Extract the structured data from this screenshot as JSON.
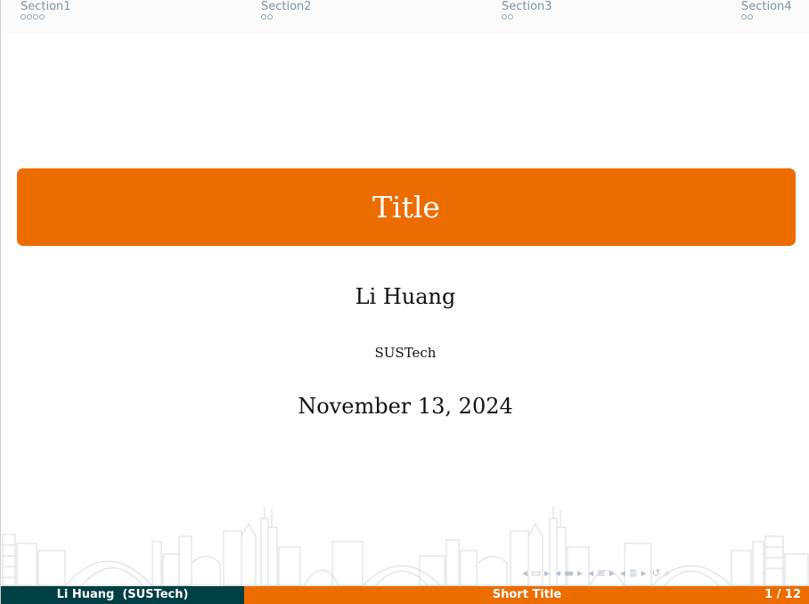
{
  "navbar": {
    "sections": [
      {
        "label": "Section1",
        "dots": 4
      },
      {
        "label": "Section2",
        "dots": 2
      },
      {
        "label": "Section3",
        "dots": 2
      },
      {
        "label": "Section4",
        "dots": 2
      }
    ]
  },
  "title": "Title",
  "author": "Li Huang",
  "institute": "SUSTech",
  "date": "November 13, 2024",
  "footer": {
    "left": "Li Huang  (SUSTech)",
    "center": "Short Title",
    "page": "1 / 12"
  },
  "colors": {
    "accent": "#ed6c00",
    "dark": "#003f43",
    "nav_text": "#7b93a8"
  }
}
